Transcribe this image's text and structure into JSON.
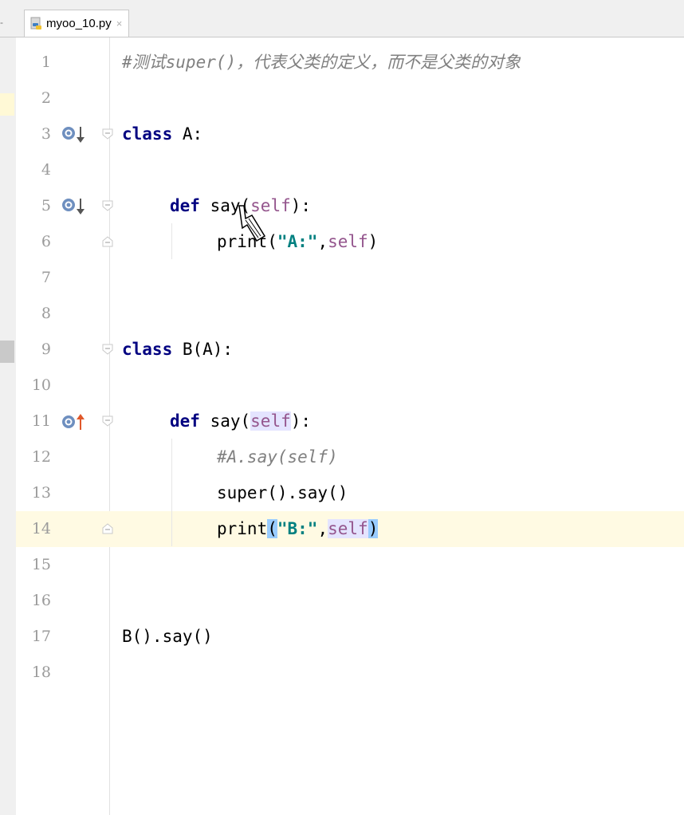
{
  "tab": {
    "filename": "myoo_10.py",
    "close": "×",
    "icon": "python-file-icon"
  },
  "line_numbers": [
    "1",
    "2",
    "3",
    "4",
    "5",
    "6",
    "7",
    "8",
    "9",
    "10",
    "11",
    "12",
    "13",
    "14",
    "15",
    "16",
    "17",
    "18"
  ],
  "code": {
    "l1_comment": "#测试super()，代表父类的定义，而不是父类的对象",
    "l3_kw": "class",
    "l3_rest": " A:",
    "l5_kw": "def",
    "l5_name": " say(",
    "l5_self": "self",
    "l5_end": "):",
    "l6_func": "print(",
    "l6_str": "\"A:\"",
    "l6_comma": ",",
    "l6_self": "self",
    "l6_end": ")",
    "l9_kw": "class",
    "l9_rest": " B(A):",
    "l11_kw": "def",
    "l11_name": " say(",
    "l11_self": "self",
    "l11_end": "):",
    "l12_comment": "#A.say(self)",
    "l13_code": "super().say()",
    "l14_func": "print",
    "l14_open": "(",
    "l14_str": "\"B:\"",
    "l14_comma": ",",
    "l14_self": "self",
    "l14_close": ")",
    "l17_code": "B().say()"
  },
  "gutter_icons": {
    "l3": "overridden-down-icon",
    "l5": "overridden-down-icon",
    "l11": "overrides-up-icon"
  },
  "colors": {
    "keyword": "#000080",
    "string": "#008080",
    "self": "#94558d",
    "comment": "#808080",
    "line_number": "#9b9b9b",
    "current_line": "#fffae3",
    "brace_match": "#99ccff"
  }
}
